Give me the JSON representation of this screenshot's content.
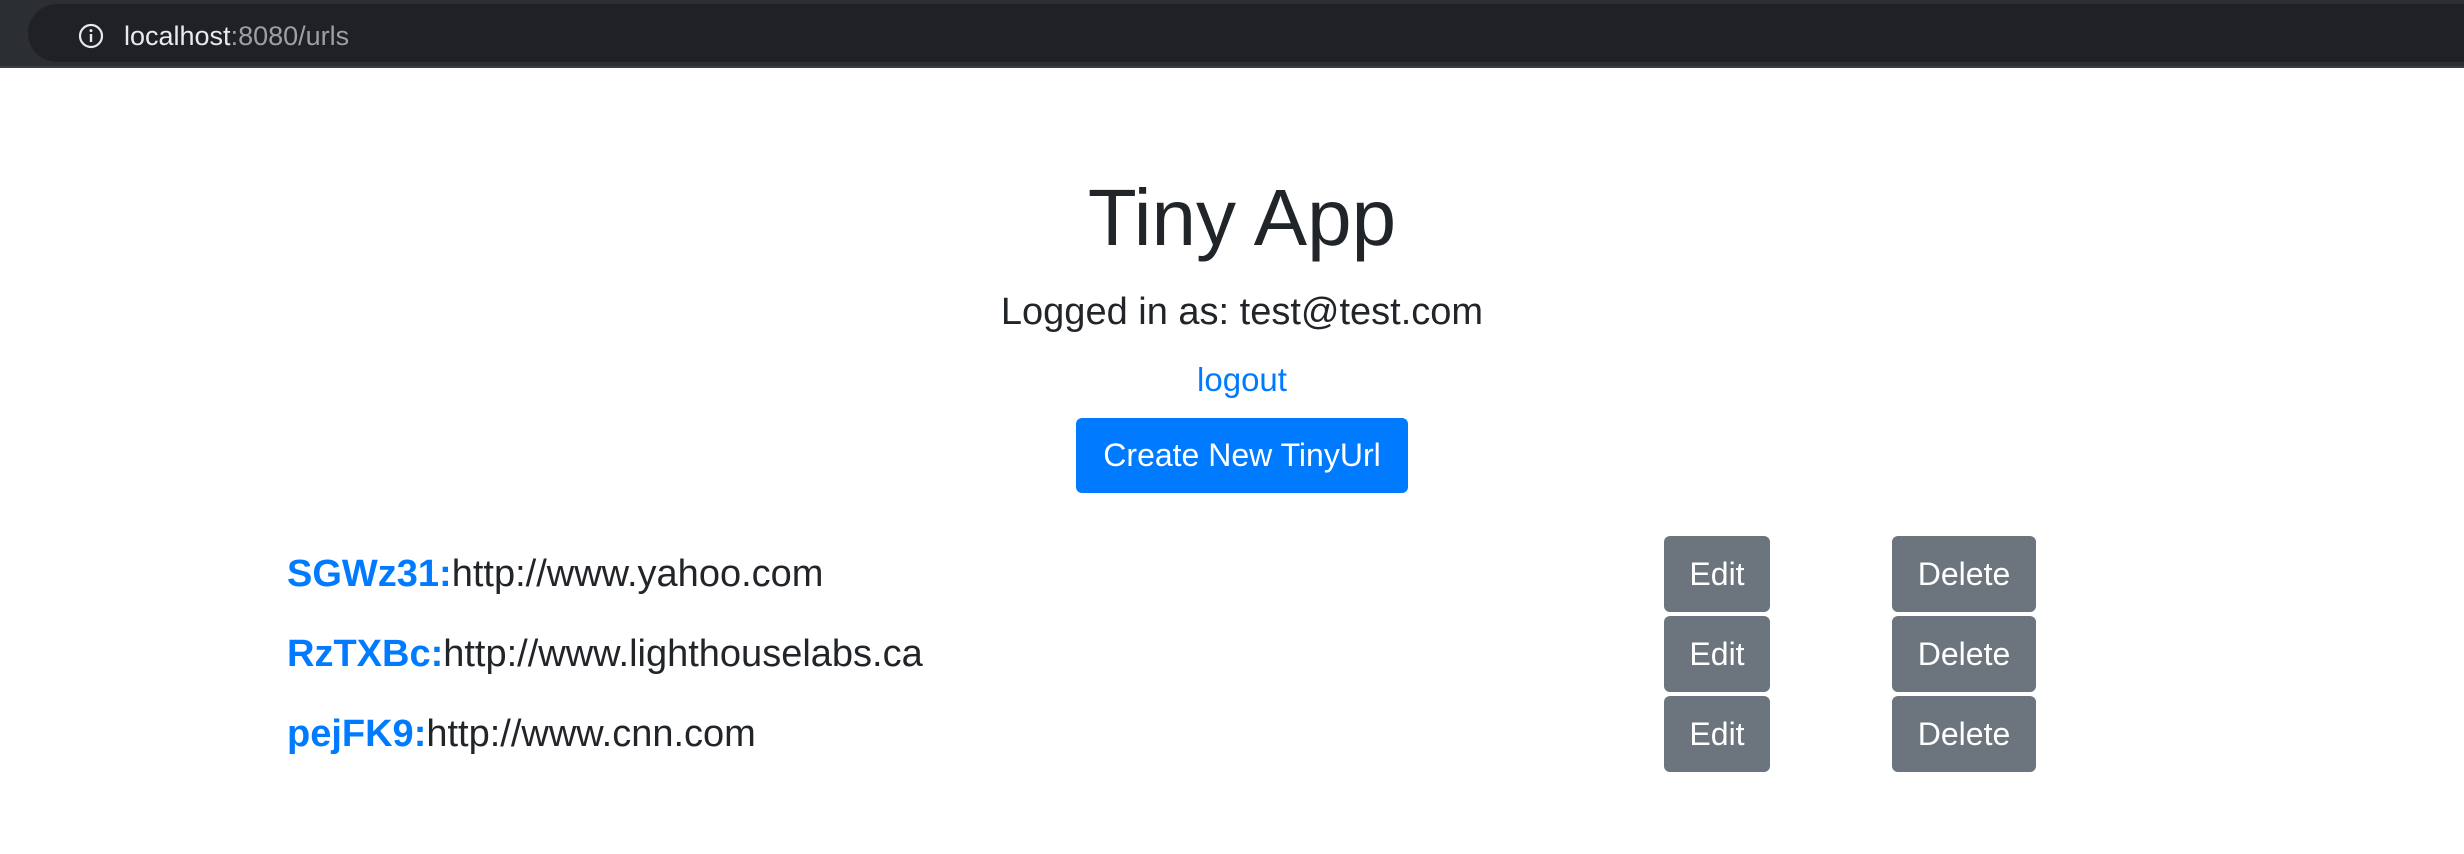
{
  "browser": {
    "url_host": "localhost",
    "url_rest": ":8080/urls",
    "info_icon": "info-icon"
  },
  "page": {
    "title": "Tiny App",
    "logged_in_text": "Logged in as: test@test.com",
    "logout_label": "logout",
    "create_button_label": "Create New TinyUrl"
  },
  "urls": [
    {
      "short": "SGWz31:",
      "long": "http://www.yahoo.com",
      "edit_label": "Edit",
      "delete_label": "Delete"
    },
    {
      "short": "RzTXBc:",
      "long": "http://www.lighthouselabs.ca",
      "edit_label": "Edit",
      "delete_label": "Delete"
    },
    {
      "short": "pejFK9:",
      "long": "http://www.cnn.com",
      "edit_label": "Edit",
      "delete_label": "Delete"
    }
  ],
  "colors": {
    "primary": "#007bff",
    "secondary": "#6c757d",
    "text": "#212529",
    "browser_bar": "#2b2e32"
  }
}
